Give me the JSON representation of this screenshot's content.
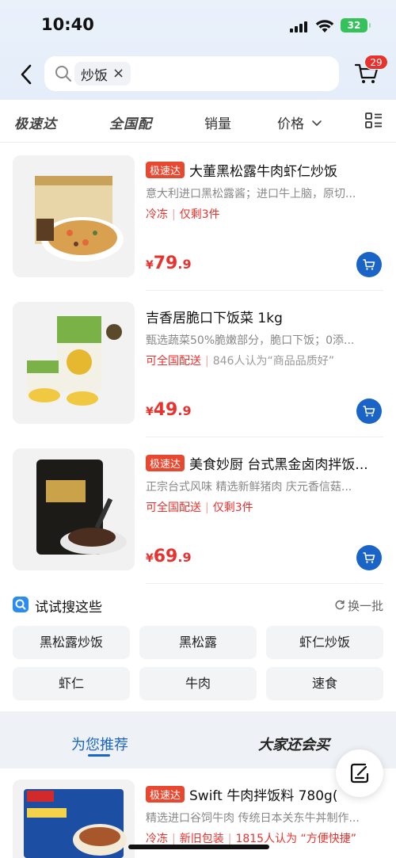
{
  "status_bar": {
    "time": "10:40",
    "battery": "32"
  },
  "header": {
    "search_chip": "炒饭",
    "cart_badge": "29"
  },
  "filter_bar": {
    "items": [
      "极速达",
      "全国配",
      "销量",
      "价格"
    ]
  },
  "products": [
    {
      "tag": "极速达",
      "title": "大董黑松露牛肉虾仁炒饭",
      "desc": "意大利进口黑松露酱；进口牛上脑，原切...",
      "meta_a": "冷冻",
      "meta_b": "仅剩3件",
      "meta_c": "",
      "price_int": "79",
      "price_dec": ".9",
      "currency": "¥",
      "thumb_text": "黑松露牛肉虾仁炒饭"
    },
    {
      "tag": "",
      "title": "吉香居脆口下饭菜 1kg",
      "desc": "甄选蔬菜50%脆嫩部分，脆口下饭；0添...",
      "meta_a": "可全国配送",
      "meta_b": "846人认为",
      "meta_c": "“商品品质好”",
      "price_int": "49",
      "price_dec": ".9",
      "currency": "¥",
      "thumb_text": "脆口下饭菜"
    },
    {
      "tag": "极速达",
      "title": "美食妙厨 台式黑金卤肉拌饭...",
      "desc": "正宗台式风味 精选新鲜猪肉 庆元香信菇...",
      "meta_a": "可全国配送",
      "meta_b": "仅剩3件",
      "meta_c": "",
      "price_int": "69",
      "price_dec": ".9",
      "currency": "¥",
      "thumb_text": "黑金卤肉拌饭酱"
    },
    {
      "tag": "极速达",
      "title": "Swift 牛肉拌饭料 780g(",
      "desc": "精选进口谷饲牛肉 传统日本关东牛丼制作...",
      "meta_a": "冷冻",
      "meta_b": "新旧包装",
      "meta_c": "1815人认为 “方便快捷”",
      "price_int": "",
      "price_dec": "",
      "currency": "",
      "thumb_text": "牛肉拌饭料"
    }
  ],
  "try_search": {
    "title": "试试搜这些",
    "refresh": "换一批",
    "chips": [
      "黑松露炒饭",
      "黑松露",
      "虾仁炒饭",
      "虾仁",
      "牛肉",
      "速食"
    ]
  },
  "recommend": {
    "tab_active": "为您推荐",
    "tab_other": "大家还会买"
  },
  "colors": {
    "accent": "#1a64c8",
    "price": "#e8322e",
    "tag": "#e8482f"
  }
}
